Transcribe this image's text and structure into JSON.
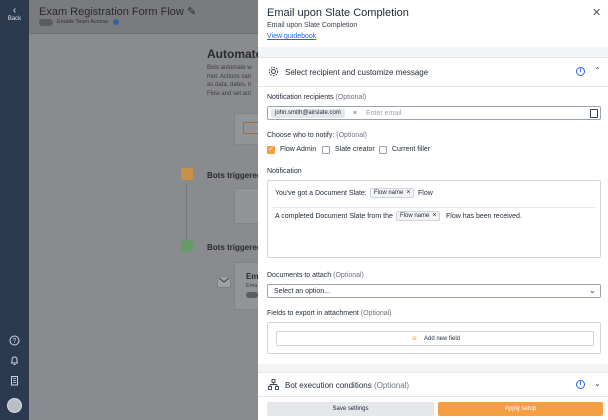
{
  "rail": {
    "back_label": "Back"
  },
  "background": {
    "form_title": "Exam Registration Form Flow",
    "toggle_label": "Enable Team Access",
    "heading": "Automate",
    "description": "Bots automate w met. Actions can as data, dates, n Flow and set aut",
    "section1_label": "Bots triggered",
    "section2_label": "Bots triggered",
    "card_title": "Em",
    "card_sub": "Ema"
  },
  "panel": {
    "title": "Email upon Slate Completion",
    "subtitle": "Email upon Slate Completion",
    "guide_link": "View guidebook",
    "section1": {
      "title": "Select recipient and customize message",
      "recipients_label": "Notification recipients",
      "optional": "(Optional)",
      "recipient_chip": "john.smith@airslate.com",
      "email_placeholder": "Enter email",
      "notify_label": "Choose who to notify:",
      "notify_options": [
        {
          "label": "Flow Admin",
          "checked": true
        },
        {
          "label": "Slate creator",
          "checked": false
        },
        {
          "label": "Current filler",
          "checked": false
        }
      ],
      "notification_label": "Notification",
      "subject_prefix": "You've got a Document Slate:",
      "subject_tag": "Flow name",
      "subject_suffix": "Flow",
      "body_prefix": "A completed Document Slate from the",
      "body_tag": "Flow name",
      "body_suffix": "Flow has been received.",
      "documents_label": "Documents to attach",
      "documents_placeholder": "Select an option...",
      "fields_label": "Fields to export in attachment",
      "add_field_label": "Add new field"
    },
    "section2": {
      "title": "Bot execution conditions",
      "optional": "(Optional)"
    },
    "footer": {
      "save_label": "Save settings",
      "apply_label": "Apply setup"
    }
  },
  "colors": {
    "accent": "#f59e42",
    "link": "#2563eb",
    "rail": "#2b3a4f"
  },
  "icons": [
    "back-chevron-icon",
    "help-icon",
    "bell-icon",
    "building-icon",
    "gear-icon",
    "info-icon",
    "chevron-up-icon",
    "chevron-down-icon",
    "close-icon",
    "address-book-icon",
    "add-field-icon",
    "tree-icon",
    "edit-pencil-icon",
    "mail-icon"
  ]
}
